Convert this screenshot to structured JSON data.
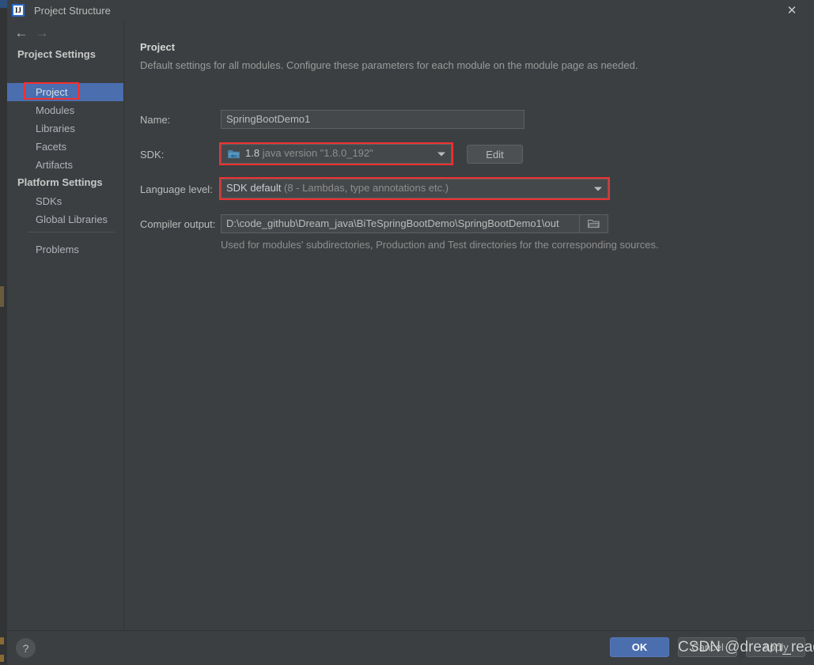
{
  "window": {
    "title": "Project Structure",
    "app_icon": "IJ",
    "close_icon": "✕"
  },
  "nav": {
    "back_icon": "←",
    "forward_icon": "→"
  },
  "sidebar": {
    "groups": [
      {
        "label": "Project Settings"
      },
      {
        "label": "Platform Settings"
      }
    ],
    "items": [
      {
        "label": "Project",
        "selected": true
      },
      {
        "label": "Modules",
        "selected": false
      },
      {
        "label": "Libraries",
        "selected": false
      },
      {
        "label": "Facets",
        "selected": false
      },
      {
        "label": "Artifacts",
        "selected": false
      },
      {
        "label": "SDKs",
        "selected": false
      },
      {
        "label": "Global Libraries",
        "selected": false
      },
      {
        "label": "Problems",
        "selected": false
      }
    ]
  },
  "main": {
    "title": "Project",
    "subtitle": "Default settings for all modules. Configure these parameters for each module on the module page as needed.",
    "fields": {
      "name_label": "Name:",
      "name_value": "SpringBootDemo1",
      "sdk_label": "SDK:",
      "sdk_value_primary": "1.8",
      "sdk_value_secondary": "java version \"1.8.0_192\"",
      "sdk_edit_label": "Edit",
      "language_level_label": "Language level:",
      "language_level_primary": "SDK default",
      "language_level_secondary": "(8 - Lambdas, type annotations etc.)",
      "compiler_output_label": "Compiler output:",
      "compiler_output_value": "D:\\code_github\\Dream_java\\BiTeSpringBootDemo\\SpringBootDemo1\\out",
      "compiler_output_hint": "Used for modules' subdirectories, Production and Test directories for the corresponding sources."
    }
  },
  "footer": {
    "help_label": "?",
    "ok_label": "OK",
    "cancel_label": "Cancel",
    "apply_label": "Apply"
  },
  "watermark": {
    "text": "CSDN @dream_ready"
  },
  "colors": {
    "accent_blue": "#4b6eaf",
    "highlight_red": "#f03030",
    "panel_bg": "#3c3f41",
    "field_bg": "#45484a"
  }
}
